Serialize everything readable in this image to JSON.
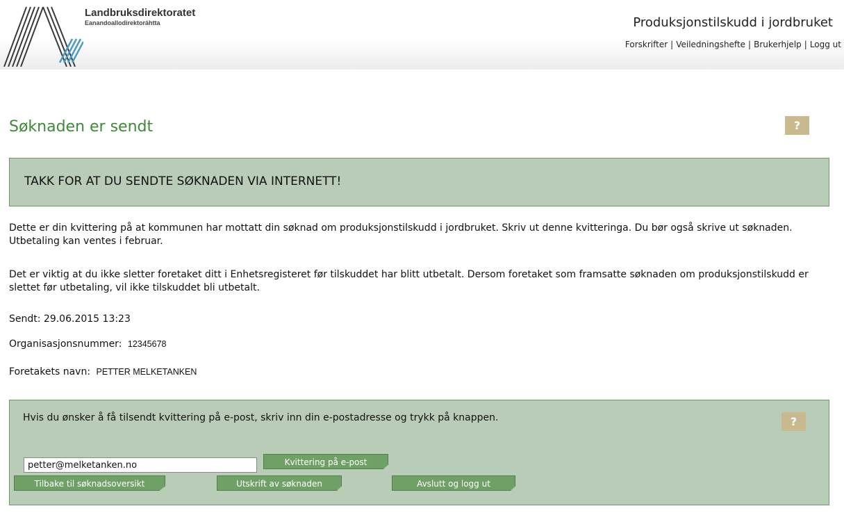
{
  "header": {
    "org_name": "Landbruksdirektoratet",
    "org_subtitle": "Eanandoallodirektoráhtta",
    "app_title": "Produksjonstilskudd i jordbruket",
    "nav": [
      "Forskrifter",
      "Veiledningshefte",
      "Brukerhjelp",
      "Logg ut"
    ],
    "nav_separator": "|"
  },
  "page": {
    "title": "Søknaden er sendt",
    "help_label": "?"
  },
  "banner": {
    "text": "TAKK FOR AT DU SENDTE SØKNADEN VIA INTERNETT!"
  },
  "info": {
    "paragraph1": "Dette er din kvittering på at kommunen har mottatt din søknad om produksjonstilskudd i jordbruket. Skriv ut denne kvitteringa. Du bør også skrive ut søknaden. Utbetaling kan ventes i februar.",
    "paragraph2": "Det er viktig at du ikke sletter foretaket ditt i Enhetsregisteret før tilskuddet har blitt utbetalt. Dersom foretaket som framsatte søknaden om produksjonstilskudd er slettet før utbetaling, vil ikke tilskuddet bli utbetalt.",
    "sent_label": "Sendt:",
    "sent_value": "29.06.2015 13:23",
    "org_number_label": "Organisasjonsnummer:",
    "org_number_value": "12345678",
    "company_label": "Foretakets navn:",
    "company_value": "PETTER MELKETANKEN"
  },
  "email_section": {
    "text": "Hvis du ønsker å få tilsendt kvittering på e-post, skriv inn din e-postadresse og trykk på knappen.",
    "help_label": "?",
    "email_value": "petter@melketanken.no",
    "send_button": "Kvittering på e-post"
  },
  "actions": {
    "back": "Tilbake til søknadsoversikt",
    "print": "Utskrift av søknaden",
    "exit": "Avslutt og logg ut"
  },
  "colors": {
    "title_green": "#3f8a36",
    "panel_bg": "#b9ccb7",
    "panel_border": "#6a9a62",
    "button_bg": "#6fa167",
    "help_bg": "#c8b98f"
  }
}
